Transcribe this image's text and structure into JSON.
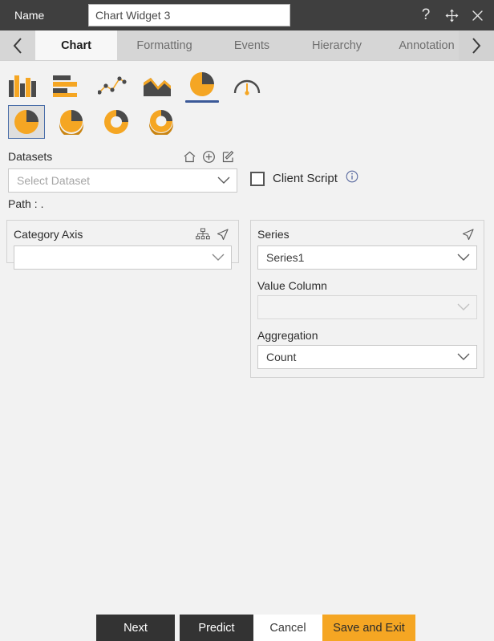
{
  "titlebar": {
    "name_label": "Name",
    "widget_name": "Chart Widget 3",
    "name_placeholder": "Name",
    "help_icon": "question-mark-icon",
    "move_icon": "move-arrows-icon",
    "close_icon": "close-x-icon"
  },
  "tabs": {
    "prev_arrow": "chevron-left-icon",
    "next_arrow": "chevron-right-icon",
    "items": [
      {
        "label": "Chart",
        "active": true
      },
      {
        "label": "Formatting",
        "active": false
      },
      {
        "label": "Events",
        "active": false
      },
      {
        "label": "Hierarchy",
        "active": false
      },
      {
        "label": "Annotation",
        "active": false
      }
    ]
  },
  "chart_types": {
    "primary": [
      {
        "name": "column-chart-icon",
        "selected": false
      },
      {
        "name": "bar-chart-icon",
        "selected": false
      },
      {
        "name": "line-chart-icon",
        "selected": false
      },
      {
        "name": "area-chart-icon",
        "selected": false
      },
      {
        "name": "pie-chart-icon",
        "selected": true
      },
      {
        "name": "gauge-chart-icon",
        "selected": false
      }
    ],
    "subtypes": [
      {
        "name": "pie-flat-icon",
        "selected": true
      },
      {
        "name": "pie-3d-icon",
        "selected": false
      },
      {
        "name": "donut-flat-icon",
        "selected": false
      },
      {
        "name": "donut-3d-icon",
        "selected": false
      }
    ]
  },
  "datasets": {
    "label": "Datasets",
    "home_icon": "home-icon",
    "add_icon": "add-circle-icon",
    "edit_icon": "edit-pencil-icon",
    "select_value": "Select Dataset",
    "select_placeholder": "Select Dataset",
    "path_label": "Path :",
    "path_value": "."
  },
  "client_script": {
    "label": "Client Script",
    "checked": false,
    "info_icon": "info-circle-icon"
  },
  "category_axis": {
    "title": "Category Axis",
    "hierarchy_icon": "hierarchy-tree-icon",
    "navigate_icon": "cursor-arrow-icon",
    "select_value": "",
    "select_placeholder": ""
  },
  "series": {
    "title": "Series",
    "navigate_icon": "cursor-arrow-icon",
    "series_value": "Series1",
    "value_column_label": "Value Column",
    "value_column_value": "",
    "value_column_placeholder": "",
    "aggregation_label": "Aggregation",
    "aggregation_value": "Count"
  },
  "footer": {
    "next_label": "Next",
    "predict_label": "Predict",
    "cancel_label": "Cancel",
    "save_label": "Save and Exit"
  },
  "colors": {
    "accent_orange": "#F5A623",
    "dark_gray": "#4A4A4A",
    "titlebar": "#3F3F3F",
    "selection_blue": "#3B5998"
  }
}
